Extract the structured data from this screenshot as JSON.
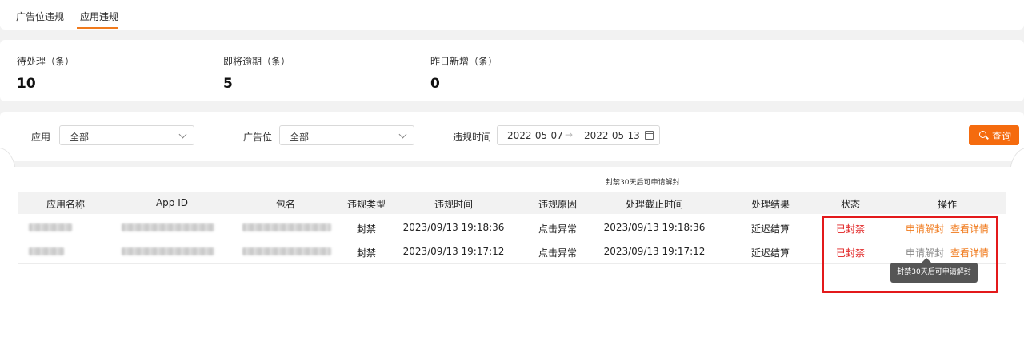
{
  "tabs": [
    {
      "label": "广告位违规",
      "active": false
    },
    {
      "label": "应用违规",
      "active": true
    }
  ],
  "stats": [
    {
      "label": "待处理（条）",
      "value": "10"
    },
    {
      "label": "即将逾期（条）",
      "value": "5"
    },
    {
      "label": "昨日新增（条）",
      "value": "0"
    }
  ],
  "filters": {
    "app_label": "应用",
    "app_value": "全部",
    "slot_label": "广告位",
    "slot_value": "全部",
    "time_label": "违规时间",
    "date_start": "2022-05-07",
    "date_end": "2022-05-13",
    "query_label": "查询"
  },
  "table": {
    "tip_top": "封禁30天后可申请解封",
    "headers": [
      "应用名称",
      "App ID",
      "包名",
      "违规类型",
      "违规时间",
      "违规原因",
      "处理截止时间",
      "处理结果",
      "状态",
      "操作"
    ],
    "rows": [
      {
        "type": "封禁",
        "time": "2023/09/13 19:18:36",
        "reason": "点击异常",
        "deadline": "2023/09/13 19:18:36",
        "result": "延迟结算",
        "status": "已封禁",
        "action1": "申请解封",
        "action2": "查看详情"
      },
      {
        "type": "封禁",
        "time": "2023/09/13 19:17:12",
        "reason": "点击异常",
        "deadline": "2023/09/13 19:17:12",
        "result": "延迟结算",
        "status": "已封禁",
        "action1": "申请解封",
        "action2": "查看详情"
      }
    ],
    "tooltip": "封禁30天后可申请解封"
  },
  "colors": {
    "accent": "#f56b0e",
    "status_red": "#e01e1e",
    "highlight": "#e3191b"
  }
}
